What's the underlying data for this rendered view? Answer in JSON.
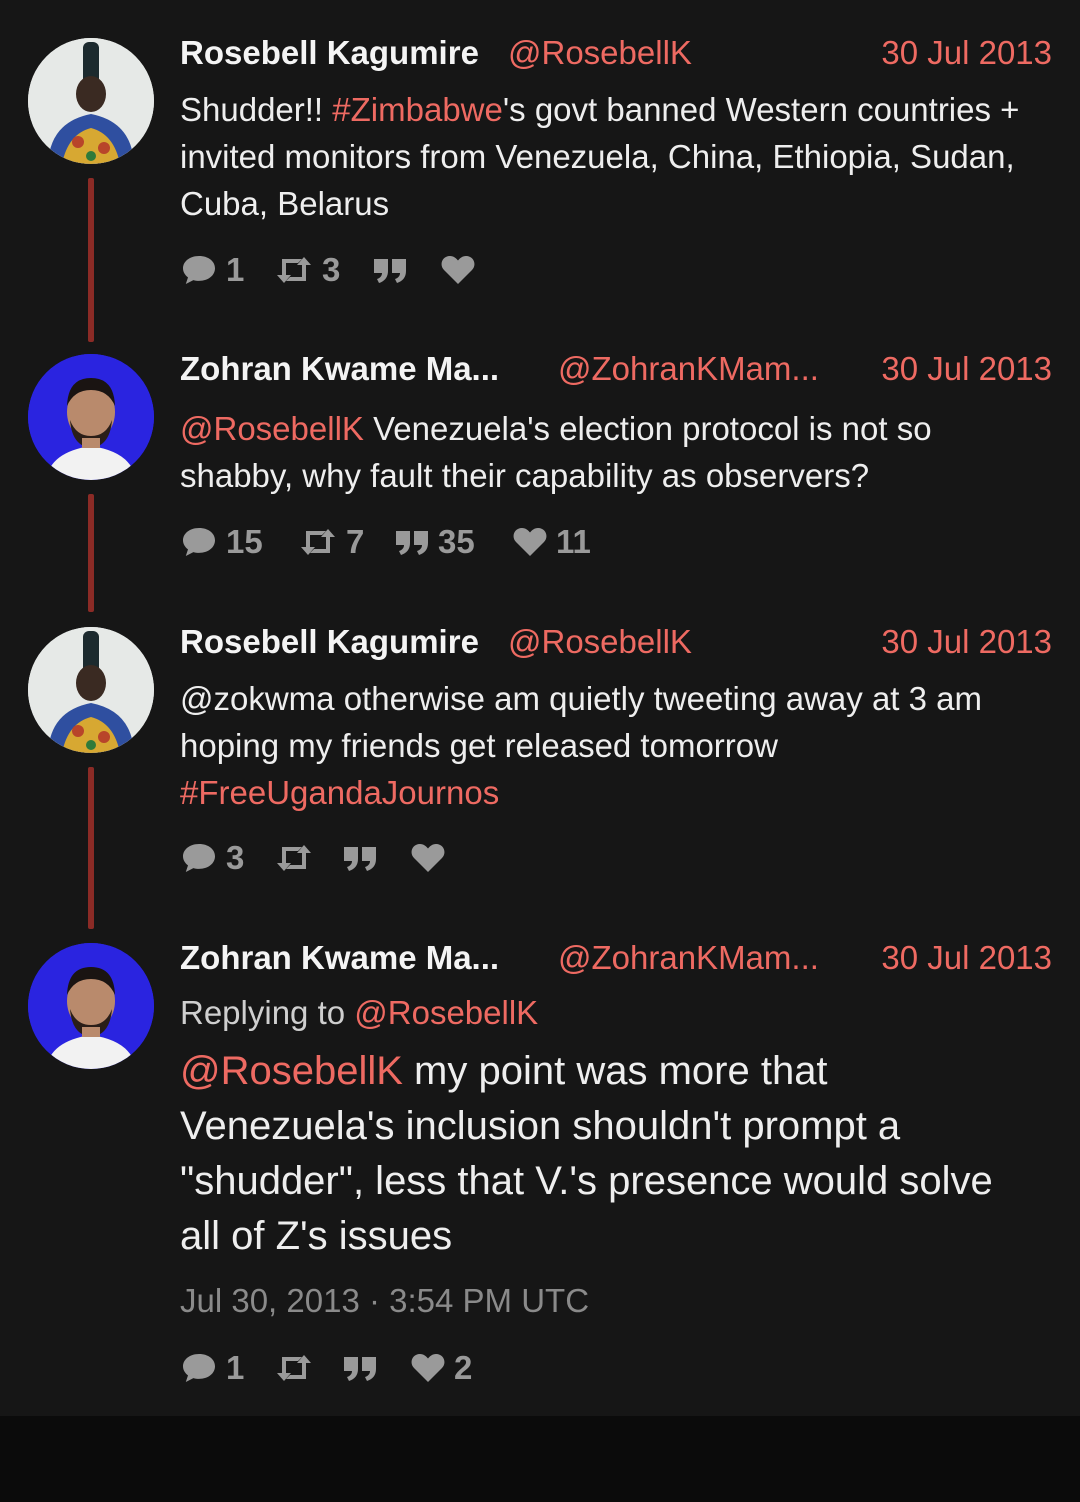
{
  "tweets": [
    {
      "name": "Rosebell Kagumire",
      "handle": "@RosebellK",
      "date": "30 Jul 2013",
      "body_before": "Shudder!! ",
      "body_link": "#Zimbabwe",
      "body_after": "'s govt banned Western countries + invited monitors from Venezuela, China, Ethiopia, Sudan, Cuba, Belarus",
      "stats": {
        "replies": "1",
        "retweets": "3",
        "quotes": "",
        "likes": ""
      }
    },
    {
      "name": "Zohran Kwame Ma...",
      "handle": "@ZohranKMam...",
      "date": "30 Jul 2013",
      "body_link": "@RosebellK",
      "body_after": " Venezuela's election protocol is not so shabby, why fault their capability as observers?",
      "stats": {
        "replies": "15",
        "retweets": "7",
        "quotes": "35",
        "likes": "11"
      }
    },
    {
      "name": "Rosebell Kagumire",
      "handle": "@RosebellK",
      "date": "30 Jul 2013",
      "body_before": "@zokwma otherwise am quietly tweeting away at 3 am hoping my friends get released tomorrow ",
      "body_link": "#FreeUgandaJournos",
      "stats": {
        "replies": "3",
        "retweets": "",
        "quotes": "",
        "likes": ""
      }
    },
    {
      "name": "Zohran Kwame Ma...",
      "handle": "@ZohranKMam...",
      "date": "30 Jul 2013",
      "replying_prefix": "Replying to ",
      "replying_handle": "@RosebellK",
      "body_link": "@RosebellK",
      "body_after": " my point was more that Venezuela's inclusion shouldn't prompt a \"shudder\", less that V.'s presence would solve all of Z's issues",
      "timestamp": "Jul 30, 2013 · 3:54 PM UTC",
      "stats": {
        "replies": "1",
        "retweets": "",
        "quotes": "",
        "likes": "2"
      }
    }
  ],
  "icons": [
    "comment-icon",
    "retweet-icon",
    "quote-icon",
    "heart-icon"
  ],
  "colors": {
    "accent": "#ee6a62",
    "background": "#161616",
    "thread_line": "#8b2b26",
    "muted": "#9a9a9a"
  }
}
